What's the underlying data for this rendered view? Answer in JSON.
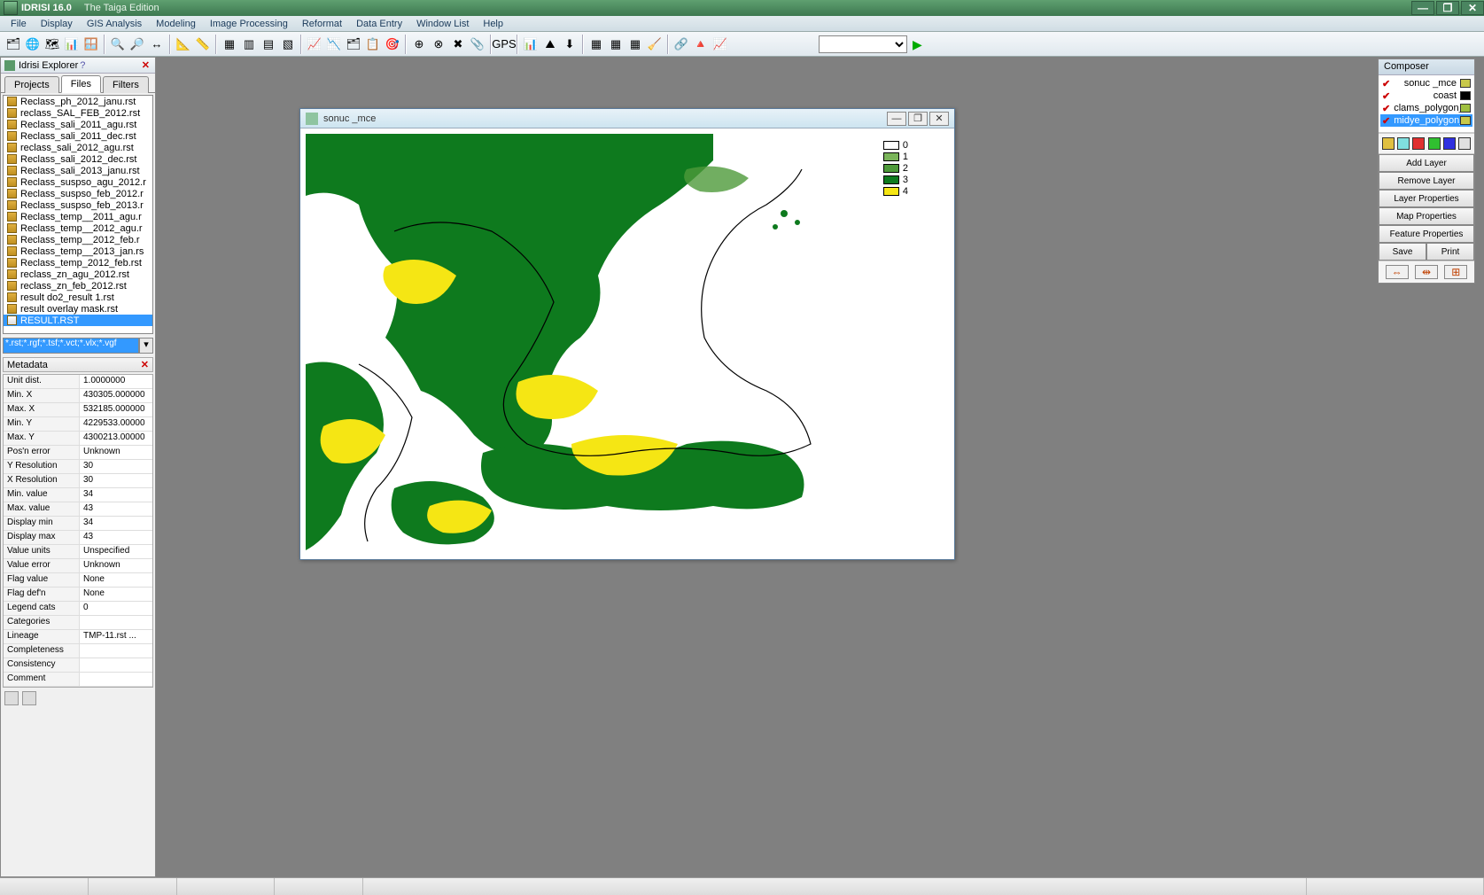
{
  "app": {
    "name": "IDRISI 16.0",
    "edition": "The Taiga Edition"
  },
  "menu": [
    "File",
    "Display",
    "GIS Analysis",
    "Modeling",
    "Image Processing",
    "Reformat",
    "Data Entry",
    "Window List",
    "Help"
  ],
  "toolbar_icons": [
    "🗂",
    "🌐",
    "🗺",
    "📊",
    "🪟",
    "|",
    "🔍",
    "🔎",
    "↔",
    "|",
    "📐",
    "📏",
    "|",
    "▦",
    "▥",
    "▤",
    "▧",
    "|",
    "📈",
    "📉",
    "🗂",
    "📋",
    "🎯",
    "|",
    "⊕",
    "⊗",
    "✖",
    "📎",
    "|",
    "GPS",
    "|",
    "📊",
    "⛰",
    "⬇",
    "|",
    "▦",
    "▦",
    "▦",
    "🧹",
    "|",
    "🔗",
    "🔺",
    "📈"
  ],
  "explorer": {
    "title": "Idrisi Explorer",
    "tabs": [
      "Projects",
      "Files",
      "Filters"
    ],
    "active_tab": "Files",
    "files": [
      "Reclass_ph_2012_janu.rst",
      "reclass_SAL_FEB_2012.rst",
      "Reclass_sali_2011_agu.rst",
      "Reclass_sali_2011_dec.rst",
      "reclass_sali_2012_agu.rst",
      "Reclass_sali_2012_dec.rst",
      "Reclass_sali_2013_janu.rst",
      "Reclass_suspso_agu_2012.r",
      "Reclass_suspso_feb_2012.r",
      "Reclass_suspso_feb_2013.r",
      "Reclass_temp__2011_agu.r",
      "Reclass_temp__2012_agu.r",
      "Reclass_temp__2012_feb.r",
      "Reclass_temp__2013_jan.rs",
      "Reclass_temp_2012_feb.rst",
      "reclass_zn_agu_2012.rst",
      "reclass_zn_feb_2012.rst",
      "result do2_result 1.rst",
      "result overlay mask.rst",
      "RESULT.RST"
    ],
    "selected_file": "RESULT.RST",
    "filter": "*.rst;*.rgf;*.tsf;*.vct;*.vlx;*.vgf"
  },
  "metadata": {
    "header": "Metadata",
    "rows": [
      {
        "label": "Unit dist.",
        "value": "1.0000000"
      },
      {
        "label": "Min. X",
        "value": "430305.000000"
      },
      {
        "label": "Max. X",
        "value": "532185.000000"
      },
      {
        "label": "Min. Y",
        "value": "4229533.00000"
      },
      {
        "label": "Max. Y",
        "value": "4300213.00000"
      },
      {
        "label": "Pos'n error",
        "value": "Unknown"
      },
      {
        "label": "Y Resolution",
        "value": "30"
      },
      {
        "label": "X Resolution",
        "value": "30"
      },
      {
        "label": "Min. value",
        "value": "34"
      },
      {
        "label": "Max. value",
        "value": "43"
      },
      {
        "label": "Display min",
        "value": "34"
      },
      {
        "label": "Display max",
        "value": "43"
      },
      {
        "label": "Value units",
        "value": "Unspecified"
      },
      {
        "label": "Value error",
        "value": "Unknown"
      },
      {
        "label": "Flag value",
        "value": "None"
      },
      {
        "label": "Flag def'n",
        "value": "None"
      },
      {
        "label": "Legend cats",
        "value": "0"
      },
      {
        "label": "Categories",
        "value": ""
      },
      {
        "label": "Lineage",
        "value": "TMP-11.rst ..."
      },
      {
        "label": "Completeness",
        "value": ""
      },
      {
        "label": "Consistency",
        "value": ""
      },
      {
        "label": "Comment",
        "value": ""
      }
    ]
  },
  "map_window": {
    "title": "sonuc _mce",
    "legend": [
      {
        "value": "0",
        "color": "#ffffff"
      },
      {
        "value": "1",
        "color": "#7ab45a"
      },
      {
        "value": "2",
        "color": "#4e9a3a"
      },
      {
        "value": "3",
        "color": "#0e7a1e"
      },
      {
        "value": "4",
        "color": "#f5e614"
      }
    ]
  },
  "composer": {
    "title": "Composer",
    "layers": [
      {
        "name": "sonuc _mce",
        "swatch": "#c8c84a",
        "checked": true,
        "selected": false
      },
      {
        "name": "coast",
        "swatch": "#000000",
        "checked": true,
        "selected": false
      },
      {
        "name": "clams_polygon_utm",
        "swatch": "#a0c040",
        "checked": true,
        "selected": false
      },
      {
        "name": "midye_polygon_utm",
        "swatch": "#c8c84a",
        "checked": true,
        "selected": true
      }
    ],
    "palette": [
      "#e0c040",
      "#80e0e0",
      "#e03030",
      "#30c030",
      "#3030e0",
      "#e0e0e0"
    ],
    "buttons": {
      "add": "Add Layer",
      "remove": "Remove Layer",
      "lprops": "Layer Properties",
      "mprops": "Map Properties",
      "fprops": "Feature Properties",
      "save": "Save",
      "print": "Print"
    }
  }
}
